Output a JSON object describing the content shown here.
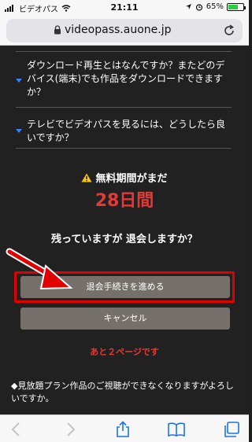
{
  "status_bar": {
    "carrier": "ビデオパス",
    "time": "21:11",
    "battery_percent": "65%",
    "battery_level": 0.65
  },
  "browser": {
    "url": "videopass.auone.jp"
  },
  "faq": [
    {
      "text": "ダウンロード再生とはなんですか？またどのデバイス(端末)でも作品をダウンロードできますか？"
    },
    {
      "text": "テレビでビデオパスを見るには、どうしたら良いですか？"
    }
  ],
  "cancel_page": {
    "warning": "無料期間がまだ",
    "days_left": "28日間",
    "question": "残っていますが 退会しますか？",
    "proceed_button": "退会手続きを進める",
    "cancel_button": "キャンセル",
    "pages_remaining": "あと２ページです",
    "notice": "◆見放題プラン作品のご視聴ができなくなりますがよろしいですか。"
  },
  "colors": {
    "accent_red": "#e53935",
    "button_bg": "#75706a",
    "background": "#212121"
  }
}
